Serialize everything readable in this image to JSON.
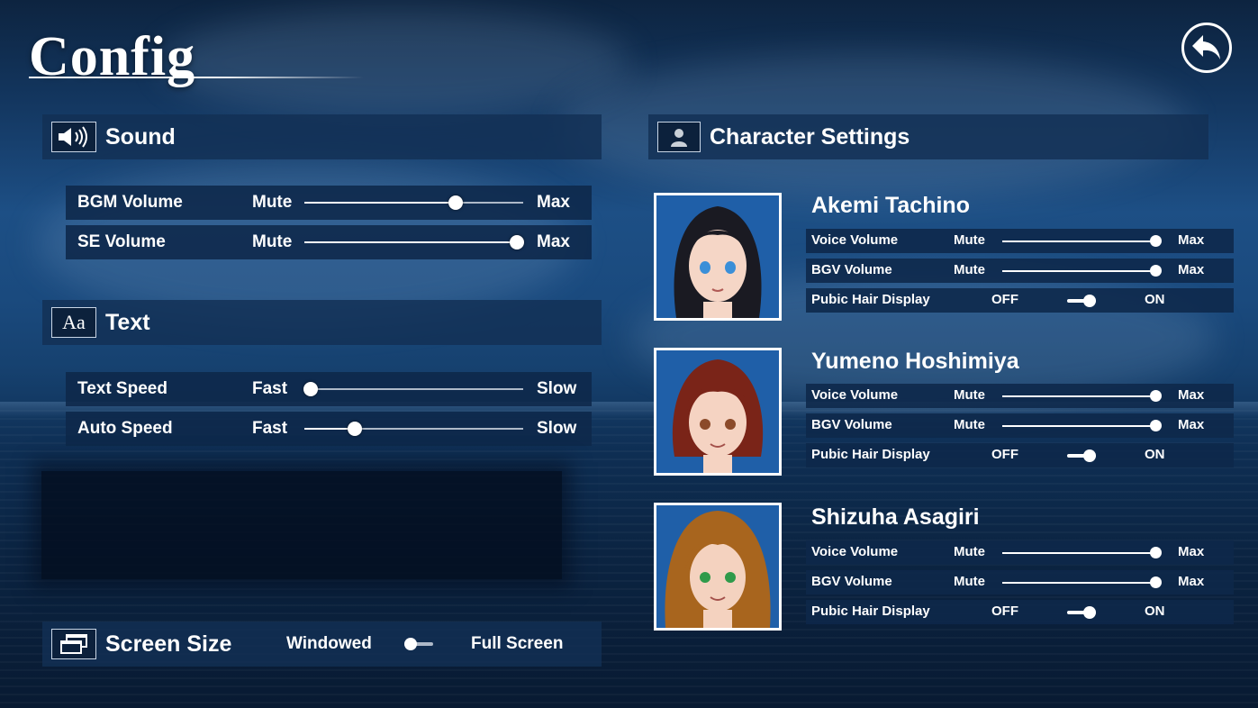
{
  "title": "Config",
  "back_button": {
    "icon": "back-arrow-icon"
  },
  "sound": {
    "label": "Sound",
    "icon": "speaker-icon",
    "rows": [
      {
        "label": "BGM Volume",
        "min": "Mute",
        "max": "Max",
        "value": 0.69
      },
      {
        "label": "SE Volume",
        "min": "Mute",
        "max": "Max",
        "value": 0.97
      }
    ]
  },
  "text": {
    "label": "Text",
    "icon": "text-aa-icon",
    "icon_text": "Aa",
    "rows": [
      {
        "label": "Text Speed",
        "min": "Fast",
        "max": "Slow",
        "value": 0.03
      },
      {
        "label": "Auto Speed",
        "min": "Fast",
        "max": "Slow",
        "value": 0.23
      }
    ]
  },
  "screen_size": {
    "label": "Screen Size",
    "icon": "windows-icon",
    "left_option": "Windowed",
    "right_option": "Full Screen",
    "selected": "Windowed"
  },
  "character_settings": {
    "label": "Character Settings",
    "icon": "person-icon",
    "characters": [
      {
        "name": "Akemi Tachino",
        "hair_color": "#1a1a22",
        "eye_color": "#3a8fd8",
        "voice": {
          "label": "Voice Volume",
          "min": "Mute",
          "max": "Max",
          "value": 1.0
        },
        "bgv": {
          "label": "BGV Volume",
          "min": "Mute",
          "max": "Max",
          "value": 1.0
        },
        "hair_display": {
          "label": "Pubic Hair Display",
          "off": "OFF",
          "on": "ON",
          "state": "ON"
        }
      },
      {
        "name": "Yumeno Hoshimiya",
        "hair_color": "#7a2418",
        "eye_color": "#8b4a2a",
        "voice": {
          "label": "Voice Volume",
          "min": "Mute",
          "max": "Max",
          "value": 1.0
        },
        "bgv": {
          "label": "BGV Volume",
          "min": "Mute",
          "max": "Max",
          "value": 1.0
        },
        "hair_display": {
          "label": "Pubic Hair Display",
          "off": "OFF",
          "on": "ON",
          "state": "ON"
        }
      },
      {
        "name": "Shizuha Asagiri",
        "hair_color": "#a8651e",
        "eye_color": "#2f9a4a",
        "voice": {
          "label": "Voice Volume",
          "min": "Mute",
          "max": "Max",
          "value": 1.0
        },
        "bgv": {
          "label": "BGV Volume",
          "min": "Mute",
          "max": "Max",
          "value": 1.0
        },
        "hair_display": {
          "label": "Pubic Hair Display",
          "off": "OFF",
          "on": "ON",
          "state": "ON"
        }
      }
    ]
  }
}
